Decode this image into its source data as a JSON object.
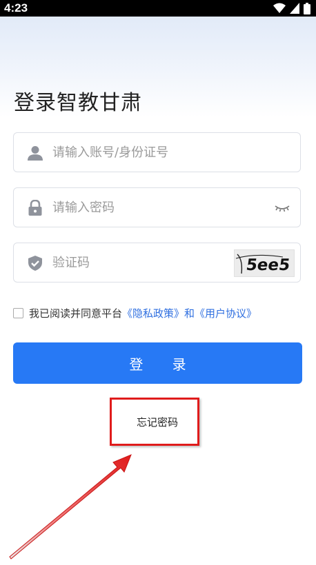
{
  "status_bar": {
    "time": "4:23"
  },
  "page": {
    "title": "登录智教甘肃"
  },
  "form": {
    "account_placeholder": "请输入账号/身份证号",
    "password_placeholder": "请输入密码",
    "captcha_placeholder": "验证码",
    "captcha_text": "5ee5"
  },
  "agreement": {
    "prefix": "我已阅读并同意平台",
    "privacy_link": "《隐私政策》",
    "conjunction": "和",
    "user_link": "《用户协议》"
  },
  "buttons": {
    "login_label": "登 录",
    "forgot_label": "忘记密码"
  },
  "colors": {
    "primary": "#2779f5",
    "highlight": "#e01b1b"
  }
}
